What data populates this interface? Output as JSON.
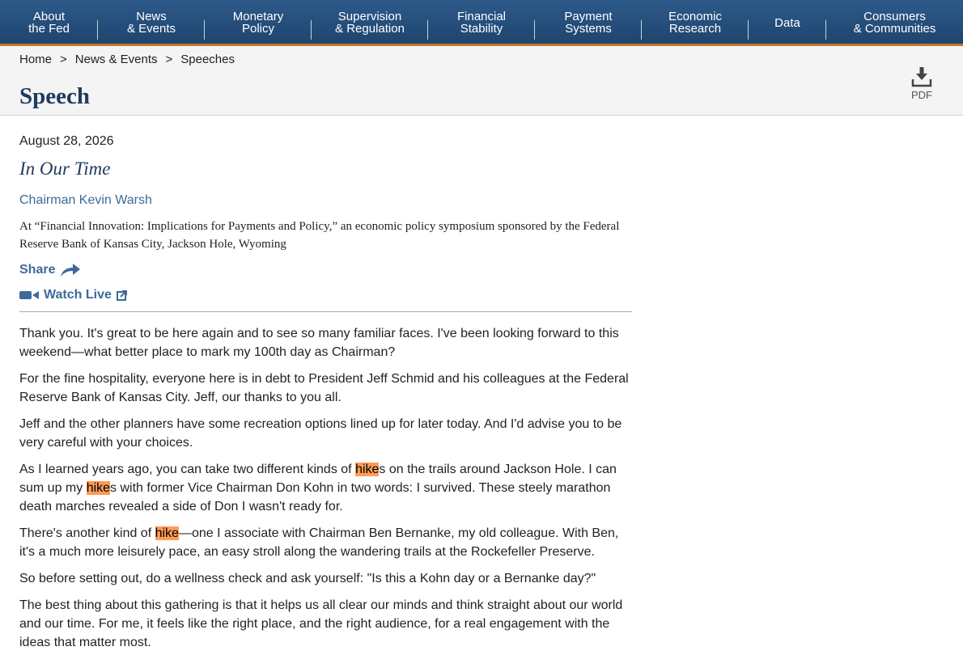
{
  "nav": [
    {
      "label": "About\nthe Fed",
      "width": 121
    },
    {
      "label": "News\n& Events",
      "width": 132
    },
    {
      "label": "Monetary\nPolicy",
      "width": 132
    },
    {
      "label": "Supervision\n& Regulation",
      "width": 144
    },
    {
      "label": "Financial\nStability",
      "width": 132
    },
    {
      "label": "Payment\nSystems",
      "width": 132
    },
    {
      "label": "Economic\nResearch",
      "width": 132
    },
    {
      "label": "Data",
      "width": 96
    },
    {
      "label": "Consumers\n& Communities",
      "width": 169
    }
  ],
  "breadcrumb": {
    "home": "Home",
    "news": "News & Events",
    "speeches": "Speeches",
    "sep": ">"
  },
  "page_title": "Speech",
  "pdf_label": "PDF",
  "date": "August 28, 2026",
  "speech_title": "In Our Time",
  "speaker": "Chairman Kevin Warsh",
  "location": "At “Financial Innovation: Implications for Payments and Policy,” an economic policy symposium sponsored by the Federal Reserve Bank of Kansas City, Jackson Hole, Wyoming",
  "share_label": "Share",
  "watch_label": "Watch Live",
  "search_highlight": "hike",
  "paragraphs": [
    "Thank you. It's great to be here again and to see so many familiar faces. I've been looking forward to this weekend—what better place to mark my 100th day as Chairman?",
    "For the fine hospitality, everyone here is in debt to President Jeff Schmid and his colleagues at the Federal Reserve Bank of Kansas City. Jeff, our thanks to you all.",
    "Jeff and the other planners have some recreation options lined up for later today. And I'd advise you to be very careful with your choices.",
    "As I learned years ago, you can take two different kinds of hikes on the trails around Jackson Hole. I can sum up my hikes with former Vice Chairman Don Kohn in two words: I survived. These steely marathon death marches revealed a side of Don I wasn't ready for.",
    "There's another kind of hike—one I associate with Chairman Ben Bernanke, my old colleague. With Ben, it's a much more leisurely pace, an easy stroll along the wandering trails at the Rockefeller Preserve.",
    "So before setting out, do a wellness check and ask yourself: \"Is this a Kohn day or a Bernanke day?\"",
    "The best thing about this gathering is that it helps us all clear our minds and think straight about our world and our time. For me, it feels like the right place, and the right audience, for a real engagement with the ideas that matter most."
  ],
  "colors": {
    "nav_bg": "#2d5a8a",
    "nav_border": "#c07a2c",
    "title": "#203b5f",
    "link": "#3d6a99",
    "highlight": "#ff9c57"
  }
}
